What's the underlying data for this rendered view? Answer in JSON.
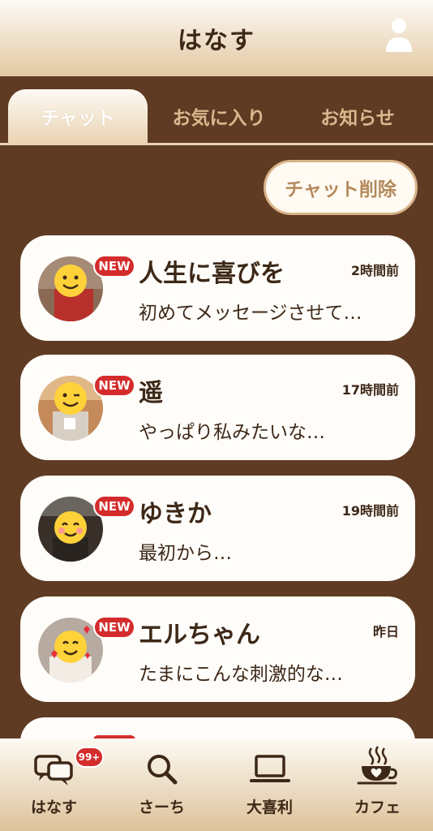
{
  "header": {
    "title": "はなす"
  },
  "tabs": [
    {
      "label": "チャット",
      "active": true
    },
    {
      "label": "お気に入り",
      "active": false
    },
    {
      "label": "お知らせ",
      "active": false
    }
  ],
  "delete_button": {
    "label": "チャット削除"
  },
  "chats": [
    {
      "name": "人生に喜びを",
      "time": "2時間前",
      "preview": "初めてメッセージさせて…",
      "badge": "NEW"
    },
    {
      "name": "遥",
      "time": "17時間前",
      "preview": "やっぱり私みたいな…",
      "badge": "NEW"
    },
    {
      "name": "ゆきか",
      "time": "19時間前",
      "preview": "最初から…",
      "badge": "NEW"
    },
    {
      "name": "エルちゃん",
      "time": "昨日",
      "preview": "たまにこんな刺激的な…",
      "badge": "NEW"
    }
  ],
  "bottom_nav": [
    {
      "label": "はなす",
      "icon": "chat-icon",
      "badge": "99+"
    },
    {
      "label": "さーち",
      "icon": "search-icon"
    },
    {
      "label": "大喜利",
      "icon": "laptop-icon"
    },
    {
      "label": "カフェ",
      "icon": "coffee-icon"
    }
  ],
  "colors": {
    "background": "#5e3b22",
    "accent": "#d42c2c",
    "text": "#3d2818",
    "card": "#fffdf9"
  }
}
